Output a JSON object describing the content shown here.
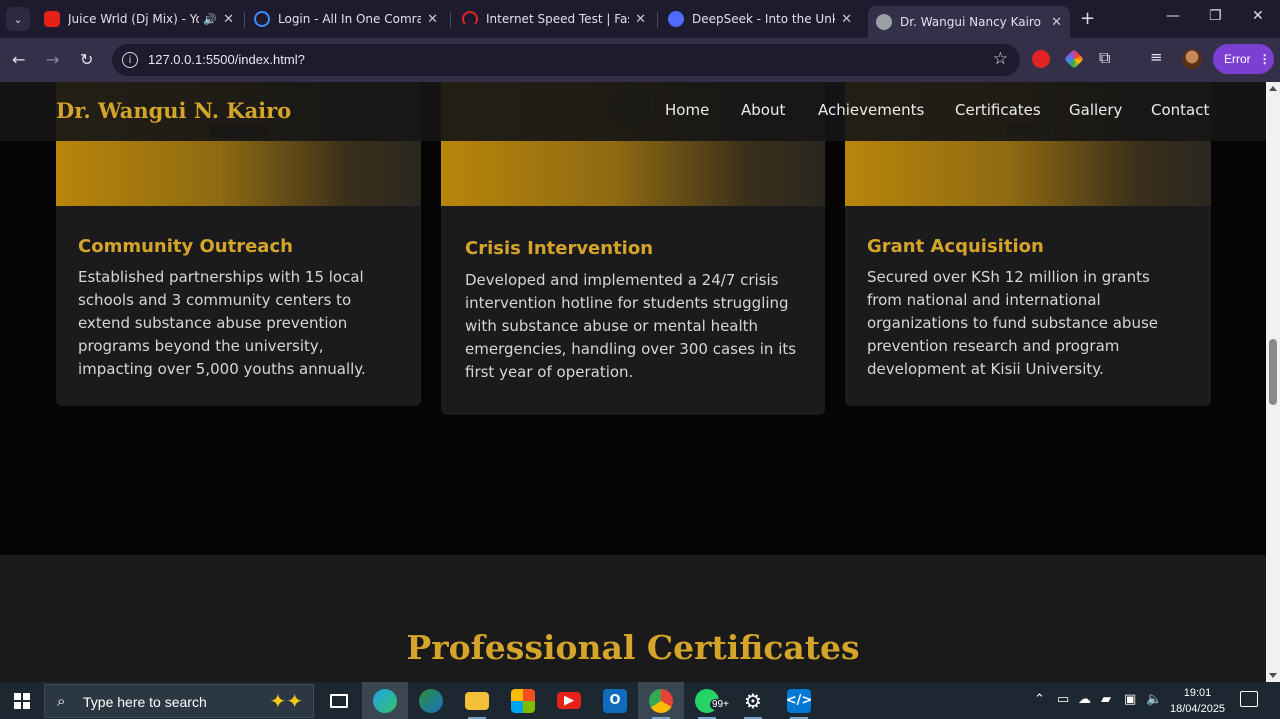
{
  "browser": {
    "tabs": [
      {
        "label": "Juice Wrld (Dj Mix) - You",
        "favicon_color": "#e62117",
        "icon": "youtube-icon"
      },
      {
        "label": "Login - All In One Comrade",
        "favicon_color": "#3d8bff",
        "icon": "loading-icon"
      },
      {
        "label": "Internet Speed Test | Fast.com",
        "favicon_color": "#e02424",
        "icon": "speedometer-icon"
      },
      {
        "label": "DeepSeek - Into the Unknown",
        "favicon_color": "#4d6bfe",
        "icon": "whale-icon"
      },
      {
        "label": "Dr. Wangui Nancy Kairo | Co",
        "favicon_color": "#9aa0a6",
        "icon": "globe-icon"
      }
    ],
    "url": "127.0.0.1:5500/index.html?",
    "error_label": "Error"
  },
  "site": {
    "logo": "Dr. Wangui N. Kairo",
    "nav": [
      "Home",
      "About",
      "Achievements",
      "Certificates",
      "Gallery",
      "Contact"
    ],
    "cards": [
      {
        "title": "Community Outreach",
        "body": "Established partnerships with 15 local schools and 3 community centers to extend substance abuse prevention programs beyond the university, impacting over 5,000 youths annually."
      },
      {
        "title": "Crisis Intervention",
        "body": "Developed and implemented a 24/7 crisis intervention hotline for students struggling with substance abuse or mental health emergencies, handling over 300 cases in its first year of operation."
      },
      {
        "title": "Grant Acquisition",
        "body": "Secured over KSh 12 million in grants from national and international organizations to fund substance abuse prevention research and program development at Kisii University."
      }
    ],
    "section_title": "Professional Certificates",
    "accent_color": "#d4a52a"
  },
  "taskbar": {
    "search_placeholder": "Type here to search",
    "whatsapp_badge": "99+",
    "time": "19:01",
    "date": "18/04/2025"
  }
}
